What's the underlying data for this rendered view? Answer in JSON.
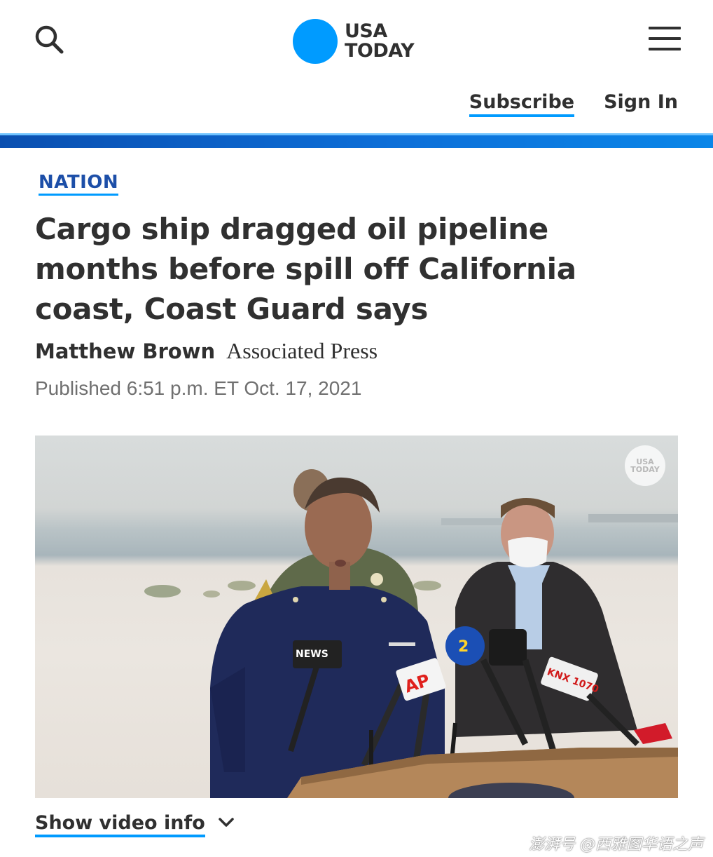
{
  "header": {
    "brand_line1": "USA",
    "brand_line2": "TODAY",
    "subscribe_label": "Subscribe",
    "signin_label": "Sign In",
    "brand_color": "#009bff",
    "icons": {
      "search": "search-icon",
      "menu": "hamburger-menu-icon",
      "expand": "chevron-down-icon"
    }
  },
  "article": {
    "category": "NATION",
    "headline": "Cargo ship dragged oil pipeline months before spill off California coast, Coast Guard says",
    "author": "Matthew Brown",
    "publisher": "Associated Press",
    "published": "Published 6:51 p.m. ET Oct. 17, 2021",
    "category_color": "#1d4fa8"
  },
  "video": {
    "watermark_line1": "USA",
    "watermark_line2": "TODAY",
    "mic_labels": [
      "NEWS",
      "AP",
      "2",
      "KNX 1070"
    ],
    "show_info_label": "Show video info"
  },
  "footer_watermark": "澎湃号 @西雅图华语之声"
}
